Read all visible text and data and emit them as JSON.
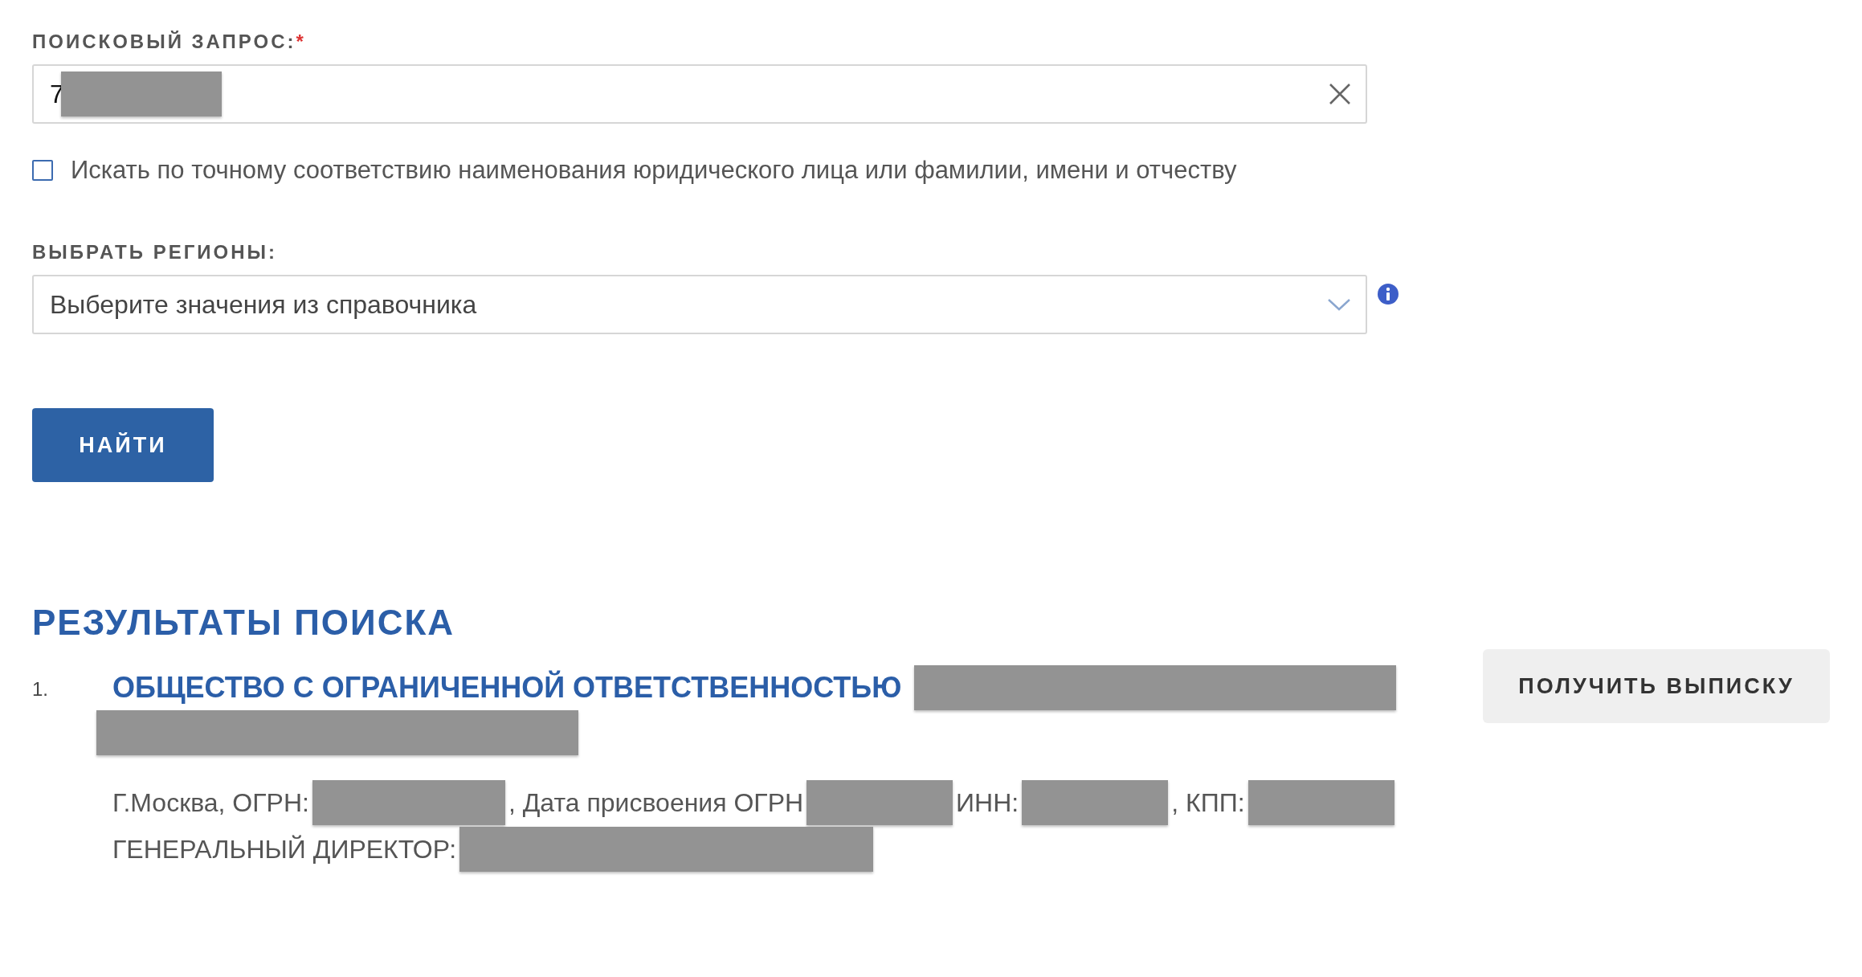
{
  "search": {
    "label": "ПОИСКОВЫЙ ЗАПРОС:",
    "required_mark": "*",
    "value": "7",
    "value_redacted": true,
    "clear_icon": true
  },
  "exact_match": {
    "label": "Искать по точному соответствию наименования юридического лица или фамилии, имени и отчеству",
    "checked": false
  },
  "regions": {
    "label": "ВЫБРАТЬ РЕГИОНЫ:",
    "placeholder": "Выберите значения из справочника"
  },
  "find_button": "НАЙТИ",
  "results": {
    "heading": "РЕЗУЛЬТАТЫ ПОИСКА",
    "items": [
      {
        "number": "1.",
        "title": [
          {
            "kind": "text",
            "text": "ОБЩЕСТВО С ОГРАНИЧЕННОЙ ОТВЕТСТВЕННОСТЬЮ"
          },
          {
            "kind": "redacted"
          },
          {
            "kind": "redacted"
          }
        ],
        "details": [
          [
            {
              "kind": "text",
              "text": "Г.Москва, ОГРН:"
            },
            {
              "kind": "redacted"
            },
            {
              "kind": "text",
              "text": ", Дата присвоения ОГРН"
            },
            {
              "kind": "redacted"
            },
            {
              "kind": "text",
              "text": "ИНН:"
            },
            {
              "kind": "redacted"
            },
            {
              "kind": "text",
              "text": ", КПП:"
            },
            {
              "kind": "redacted"
            }
          ],
          [
            {
              "kind": "text",
              "text": "ГЕНЕРАЛЬНЫЙ ДИРЕКТОР:"
            },
            {
              "kind": "redacted"
            }
          ]
        ],
        "action": "ПОЛУЧИТЬ ВЫПИСКУ"
      }
    ]
  }
}
